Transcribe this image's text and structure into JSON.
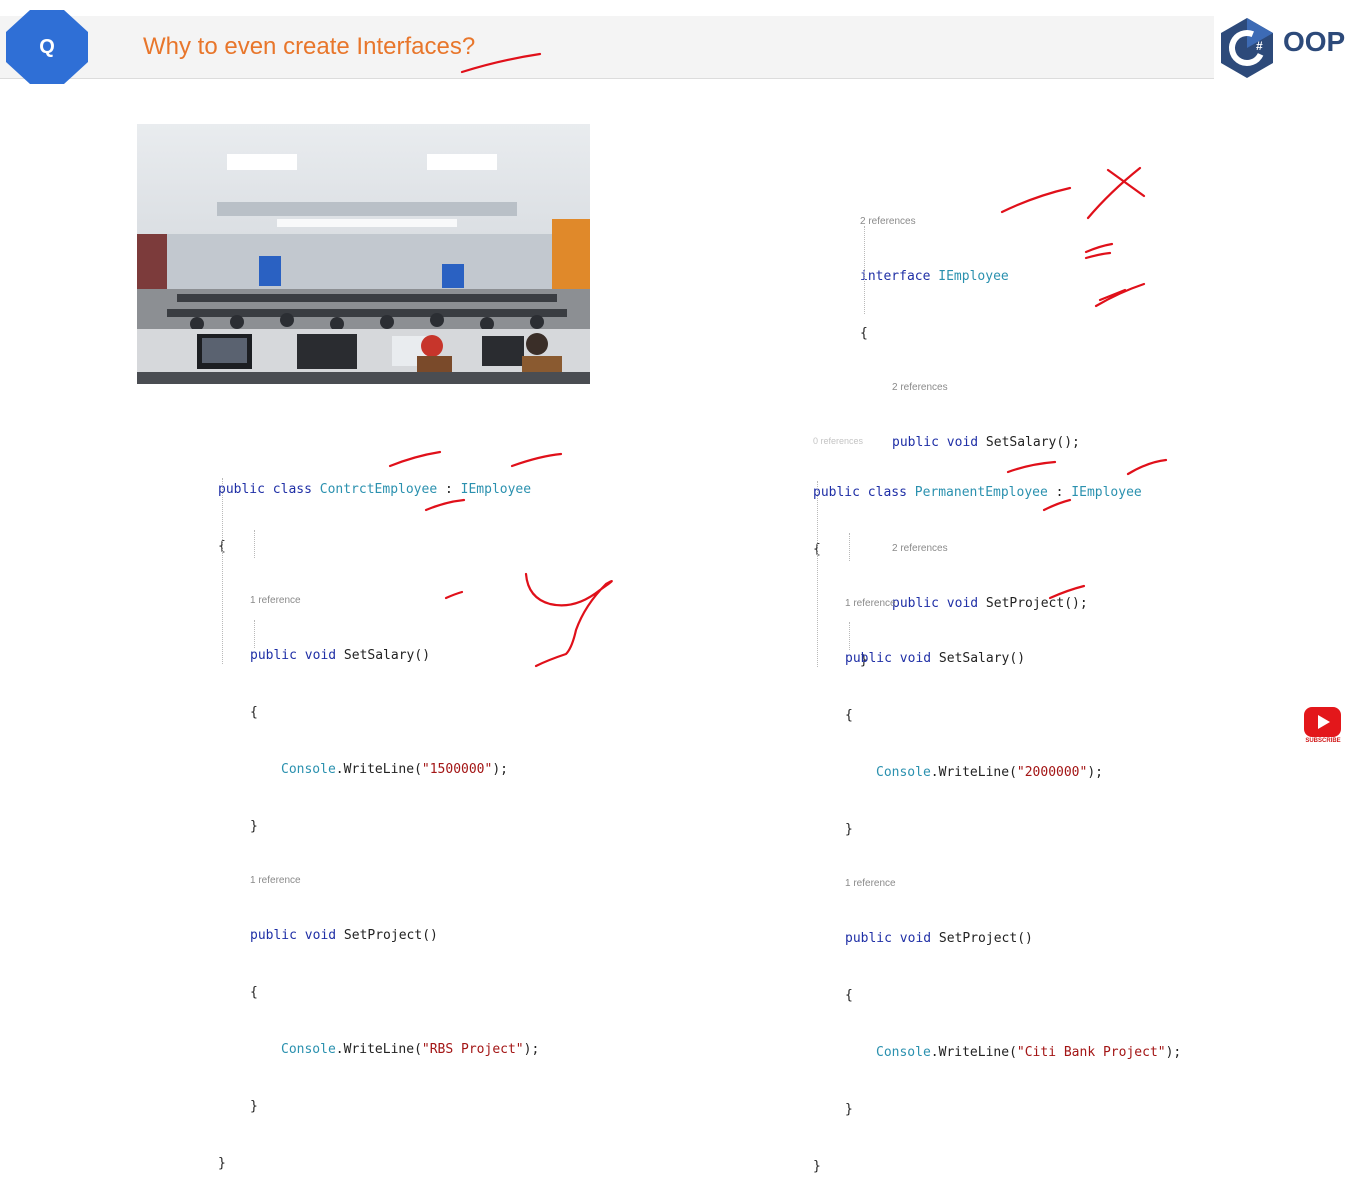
{
  "header": {
    "badge_letter": "Q",
    "title": "Why to even create Interfaces?",
    "brand_text": "OOP",
    "brand_logo_letter": "C#"
  },
  "colors": {
    "title": "#e8762b",
    "badge": "#2f6fd6",
    "keyword": "#1f2fa6",
    "type": "#2b91af",
    "string": "#a31515",
    "ink": "#e0101a"
  },
  "photo": {
    "icon": "office-photo-image"
  },
  "interface_block": {
    "ref_top": "2 references",
    "line1_kw": "interface",
    "line1_type": "IEmployee",
    "open": "{",
    "ref1": "2 references",
    "m1_kw": "public void",
    "m1_name": "SetSalary();",
    "ref2": "2 references",
    "m2_kw": "public void",
    "m2_name": "SetProject();",
    "close": "}"
  },
  "contract_block": {
    "l1_kw": "public class",
    "l1_type": "ContrctEmployee",
    "l1_sep": " : ",
    "l1_iface": "IEmployee",
    "open": "{",
    "ref1": "1 reference",
    "m1_kw": "public void",
    "m1_name": "SetSalary()",
    "m1_open": "{",
    "m1_obj": "Console",
    "m1_call": ".WriteLine(",
    "m1_str": "\"1500000\"",
    "m1_end": ");",
    "m1_close": "}",
    "ref2": "1 reference",
    "m2_kw": "public void",
    "m2_name": "SetProject()",
    "m2_open": "{",
    "m2_obj": "Console",
    "m2_call": ".WriteLine(",
    "m2_str": "\"RBS Project\"",
    "m2_end": ");",
    "m2_close": "}",
    "close": "}"
  },
  "permanent_block": {
    "ref_top": "0 references",
    "l1_kw": "public class",
    "l1_type": "PermanentEmployee",
    "l1_sep": " : ",
    "l1_iface": "IEmployee",
    "open": "{",
    "ref1": "1 reference",
    "m1_kw": "public void",
    "m1_name": "SetSalary()",
    "m1_open": "{",
    "m1_obj": "Console",
    "m1_call": ".WriteLine(",
    "m1_str": "\"2000000\"",
    "m1_end": ");",
    "m1_close": "}",
    "ref2": "1 reference",
    "m2_kw": "public void",
    "m2_name": "SetProject()",
    "m2_open": "{",
    "m2_obj": "Console",
    "m2_call": ".WriteLine(",
    "m2_str": "\"Citi Bank Project\"",
    "m2_end": ");",
    "m2_close": "}",
    "close": "}"
  },
  "subscribe": {
    "label": "SUBSCRIBE",
    "icon": "youtube-play-icon"
  }
}
